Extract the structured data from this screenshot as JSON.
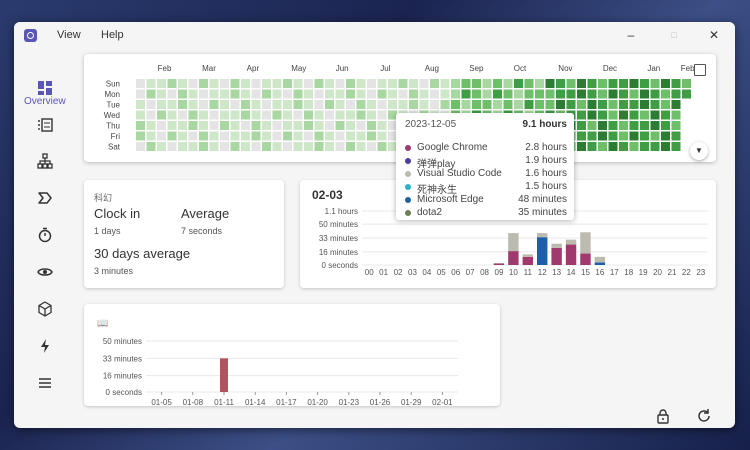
{
  "menu": {
    "view": "View",
    "help": "Help"
  },
  "window": {
    "minimize": "–",
    "maximize": "□",
    "close": "✕"
  },
  "sidebar": {
    "active_label": "Overview",
    "icons": [
      "dashboard-icon",
      "list-icon",
      "hierarchy-icon",
      "tag-icon",
      "timer-icon",
      "eye-icon",
      "cube-icon",
      "bolt-icon",
      "menu-icon"
    ]
  },
  "heatmap": {
    "months": [
      "Feb",
      "Mar",
      "Apr",
      "May",
      "Jun",
      "Jul",
      "Aug",
      "Sep",
      "Oct",
      "Nov",
      "Dec",
      "Jan",
      "Feb"
    ],
    "weekdays": [
      "Sun",
      "Mon",
      "Tue",
      "Wed",
      "Thu",
      "Fri",
      "Sat"
    ],
    "colors": {
      "empty": "#e4e4e4",
      "l1": "#cfe7c9",
      "l2": "#a9d7a1",
      "l3": "#6fbf6a",
      "l4": "#3f9d44",
      "l5": "#2c7d33"
    }
  },
  "tooltip": {
    "date": "2023-12-05",
    "total": "9.1 hours",
    "items": [
      {
        "name": "Google Chrome",
        "value": "2.8 hours",
        "color": "#a03a6e"
      },
      {
        "name": "弹弹play",
        "value": "1.9 hours",
        "color": "#4a3f9f"
      },
      {
        "name": "Visual Studio Code",
        "value": "1.6 hours",
        "color": "#bdbab0"
      },
      {
        "name": "死神永生",
        "value": "1.5 hours",
        "color": "#2bb3c7"
      },
      {
        "name": "Microsoft Edge",
        "value": "48 minutes",
        "color": "#1f5fa8"
      },
      {
        "name": "dota2",
        "value": "35 minutes",
        "color": "#6b7f55"
      }
    ]
  },
  "stats": {
    "subtitle": "科幻",
    "clock_in_label": "Clock in",
    "clock_in_value": "1 days",
    "average_label": "Average",
    "average_value": "7 seconds",
    "avg30_label": "30 days average",
    "avg30_value": "3 minutes"
  },
  "hourly": {
    "title": "02-03"
  },
  "chart_data": [
    {
      "type": "bar",
      "title": "02-03",
      "categories": [
        "00",
        "01",
        "02",
        "03",
        "04",
        "05",
        "06",
        "07",
        "08",
        "09",
        "10",
        "11",
        "12",
        "13",
        "14",
        "15",
        "16",
        "17",
        "18",
        "19",
        "20",
        "21",
        "22",
        "23"
      ],
      "yticks": [
        "0 seconds",
        "16 minutes",
        "33 minutes",
        "50 minutes",
        "1.1 hours"
      ],
      "ylim": [
        0,
        66
      ],
      "series": [
        {
          "color": "#a03a6e",
          "values": [
            0,
            0,
            0,
            0,
            0,
            0,
            0,
            0,
            0,
            2,
            17,
            10,
            0,
            21,
            25,
            14,
            0,
            0,
            0,
            0,
            0,
            0,
            0,
            0
          ]
        },
        {
          "color": "#1f5fa8",
          "values": [
            0,
            0,
            0,
            0,
            0,
            0,
            0,
            0,
            0,
            0,
            0,
            0,
            34,
            0,
            0,
            0,
            3,
            0,
            0,
            0,
            0,
            0,
            0,
            0
          ]
        },
        {
          "color": "#bdbab0",
          "values": [
            0,
            0,
            0,
            0,
            0,
            0,
            0,
            0,
            0,
            0,
            22,
            3,
            5,
            5,
            6,
            26,
            7,
            0,
            0,
            0,
            0,
            0,
            0,
            0
          ]
        }
      ]
    },
    {
      "type": "bar",
      "title": "📖",
      "categories": [
        "01-05",
        "01-08",
        "01-11",
        "01-14",
        "01-17",
        "01-20",
        "01-23",
        "01-26",
        "01-29",
        "02-01"
      ],
      "yticks": [
        "0 seconds",
        "16 minutes",
        "33 minutes",
        "50 minutes"
      ],
      "ylim": [
        0,
        50
      ],
      "bar": {
        "x": "01-11",
        "value": 33,
        "color": "#b0555e"
      }
    }
  ]
}
